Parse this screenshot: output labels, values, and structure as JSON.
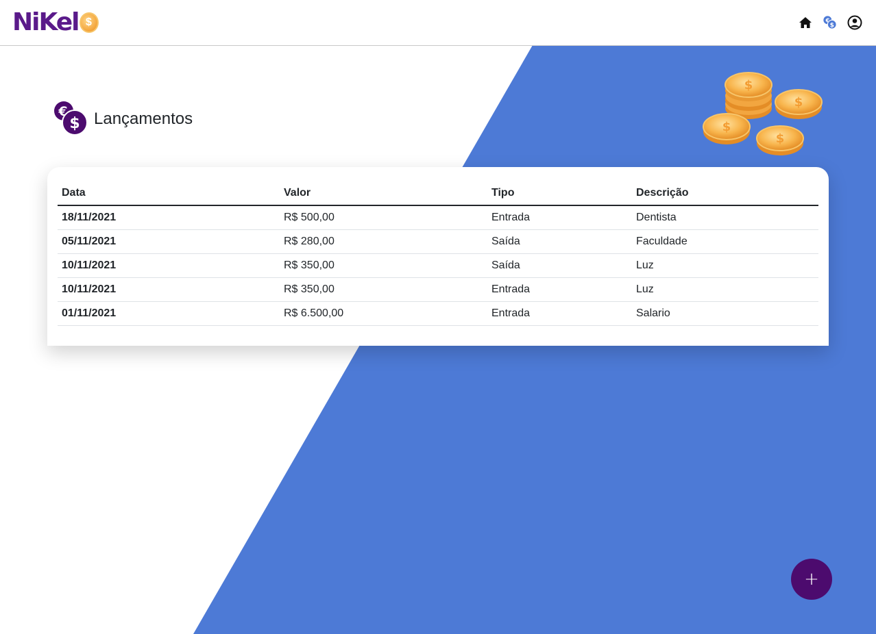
{
  "brand": {
    "name": "NiKel",
    "coin_symbol": "$"
  },
  "nav": {
    "icons": [
      "home-icon",
      "currency-exchange-icon",
      "user-circle-icon"
    ]
  },
  "page": {
    "title": "Lançamentos"
  },
  "table": {
    "columns": [
      "Data",
      "Valor",
      "Tipo",
      "Descrição"
    ],
    "rows": [
      {
        "data": "18/11/2021",
        "valor": "R$ 500,00",
        "tipo": "Entrada",
        "descricao": "Dentista"
      },
      {
        "data": "05/11/2021",
        "valor": "R$ 280,00",
        "tipo": "Saída",
        "descricao": "Faculdade"
      },
      {
        "data": "10/11/2021",
        "valor": "R$ 350,00",
        "tipo": "Saída",
        "descricao": "Luz"
      },
      {
        "data": "10/11/2021",
        "valor": "R$ 350,00",
        "tipo": "Entrada",
        "descricao": "Luz"
      },
      {
        "data": "01/11/2021",
        "valor": "R$ 6.500,00",
        "tipo": "Entrada",
        "descricao": "Salario"
      }
    ]
  },
  "fab": {
    "label": "+"
  },
  "colors": {
    "brand_purple": "#4c0b6e",
    "background_blue": "#4d7ad6",
    "coin_gold": "#f3a43a"
  }
}
